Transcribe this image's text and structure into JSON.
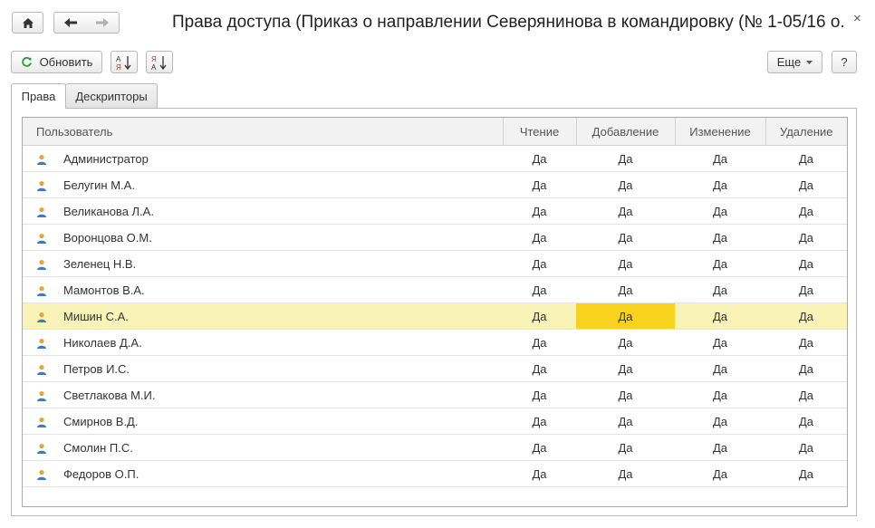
{
  "window": {
    "title": "Права доступа (Приказ о направлении Северянинова в командировку (№ 1-05/16 о...",
    "close_glyph": "×"
  },
  "toolbar": {
    "refresh_label": "Обновить",
    "more_label": "Еще",
    "help_label": "?"
  },
  "tabs": [
    {
      "label": "Права",
      "active": true
    },
    {
      "label": "Дескрипторы",
      "active": false
    }
  ],
  "table": {
    "columns": [
      "Пользователь",
      "Чтение",
      "Добавление",
      "Изменение",
      "Удаление"
    ],
    "rows": [
      {
        "name": "Администратор",
        "read": "Да",
        "add": "Да",
        "change": "Да",
        "delete": "Да"
      },
      {
        "name": "Белугин М.А.",
        "read": "Да",
        "add": "Да",
        "change": "Да",
        "delete": "Да"
      },
      {
        "name": "Великанова Л.А.",
        "read": "Да",
        "add": "Да",
        "change": "Да",
        "delete": "Да"
      },
      {
        "name": "Воронцова О.М.",
        "read": "Да",
        "add": "Да",
        "change": "Да",
        "delete": "Да"
      },
      {
        "name": "Зеленец Н.В.",
        "read": "Да",
        "add": "Да",
        "change": "Да",
        "delete": "Да"
      },
      {
        "name": "Мамонтов В.А.",
        "read": "Да",
        "add": "Да",
        "change": "Да",
        "delete": "Да"
      },
      {
        "name": "Мишин С.А.",
        "read": "Да",
        "add": "Да",
        "change": "Да",
        "delete": "Да"
      },
      {
        "name": "Николаев Д.А.",
        "read": "Да",
        "add": "Да",
        "change": "Да",
        "delete": "Да"
      },
      {
        "name": "Петров И.С.",
        "read": "Да",
        "add": "Да",
        "change": "Да",
        "delete": "Да"
      },
      {
        "name": "Светлакова М.И.",
        "read": "Да",
        "add": "Да",
        "change": "Да",
        "delete": "Да"
      },
      {
        "name": "Смирнов В.Д.",
        "read": "Да",
        "add": "Да",
        "change": "Да",
        "delete": "Да"
      },
      {
        "name": "Смолин П.С.",
        "read": "Да",
        "add": "Да",
        "change": "Да",
        "delete": "Да"
      },
      {
        "name": "Федоров О.П.",
        "read": "Да",
        "add": "Да",
        "change": "Да",
        "delete": "Да"
      }
    ],
    "selected_row": 6,
    "current_column": "add"
  },
  "colors": {
    "selected_row": "#faf3b8",
    "current_cell": "#f8d21c",
    "refresh_icon": "#2e9b3a",
    "sort_icon_red": "#c0392b",
    "user_icon_head": "#e8a23a",
    "user_icon_body": "#3a7bc8"
  },
  "icons": [
    "home-icon",
    "back-arrow-icon",
    "forward-arrow-icon",
    "refresh-icon",
    "sort-ascending-icon",
    "sort-descending-icon",
    "dropdown-caret-icon",
    "user-icon"
  ]
}
